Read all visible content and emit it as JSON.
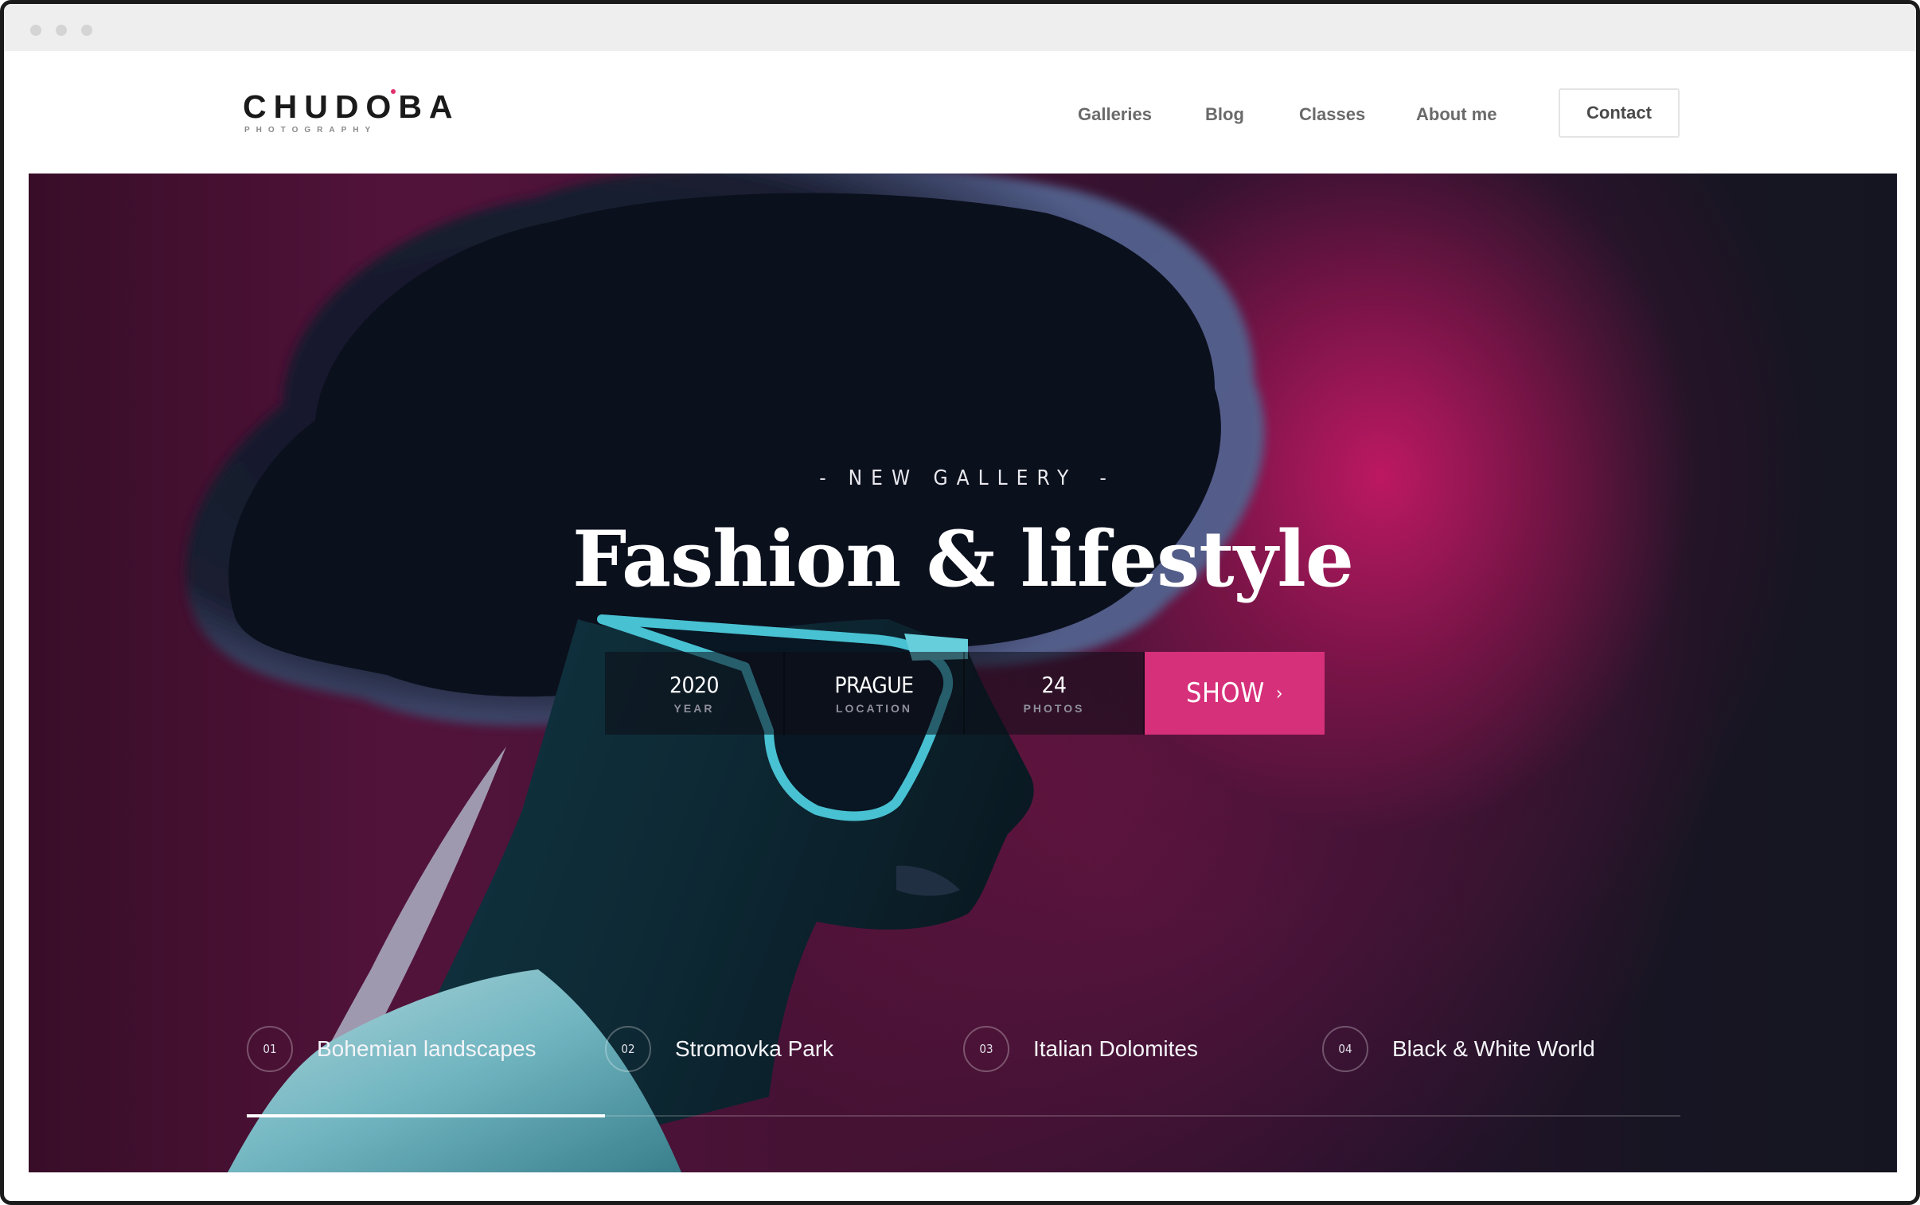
{
  "header": {
    "logo_text": "CHUDOBA",
    "logo_subtitle": "PHOTOGRAPHY",
    "nav_items": [
      "Galleries",
      "Blog",
      "Classes",
      "About me"
    ],
    "contact_label": "Contact"
  },
  "hero": {
    "eyebrow": "NEW GALLERY",
    "eyebrow_dash": "-",
    "title": "Fashion & lifestyle",
    "stats": [
      {
        "value": "2020",
        "label": "YEAR"
      },
      {
        "value": "PRAGUE",
        "label": "LOCATION"
      },
      {
        "value": "24",
        "label": "PHOTOS"
      }
    ],
    "show_label": "SHOW",
    "show_icon": "chevron-right-icon"
  },
  "galleries": [
    {
      "num": "01",
      "label": "Bohemian landscapes"
    },
    {
      "num": "02",
      "label": "Stromovka Park"
    },
    {
      "num": "03",
      "label": "Italian Dolomites"
    },
    {
      "num": "04",
      "label": "Black & White World"
    }
  ],
  "slider": {
    "active_index": 0,
    "progress_fraction": 0.25
  },
  "colors": {
    "accent": "#d6307a",
    "logo_dot": "#e0306c",
    "hero_dark": "#171724",
    "hero_magenta": "#d41c6e",
    "nav_text": "#6a6a6a"
  }
}
